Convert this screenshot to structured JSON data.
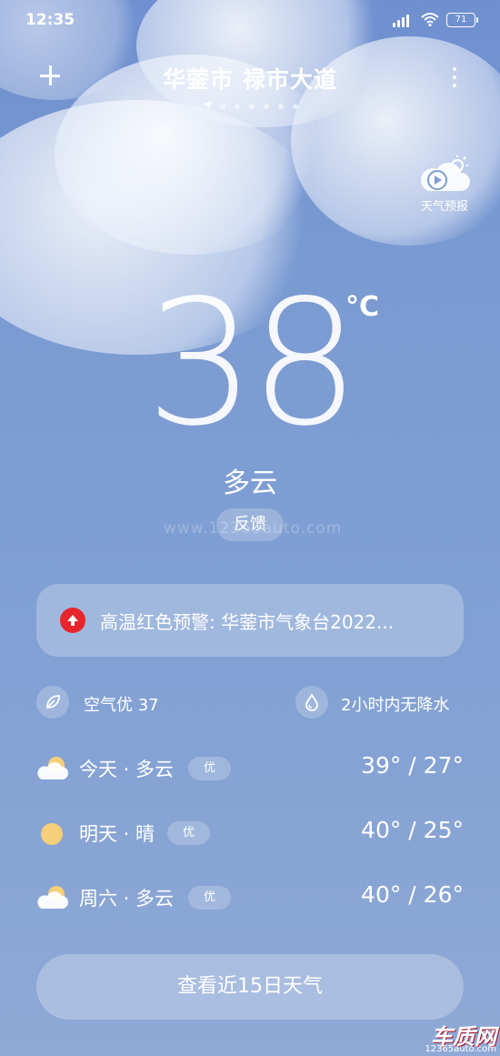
{
  "status_bar": {
    "time": "12:35",
    "battery": "71"
  },
  "header": {
    "location": "华蓥市 禄市大道",
    "forecast_video_label": "天气预报"
  },
  "current": {
    "temperature": "38",
    "unit": "°C",
    "condition": "多云",
    "feedback_label": "反馈"
  },
  "alert": {
    "text": "高温红色预警: 华蓥市气象台2022...",
    "color": "#e6262c"
  },
  "air": {
    "label": "空气优 37",
    "icon": "leaf-icon"
  },
  "precip": {
    "label": "2小时内无降水",
    "icon": "water-drop-icon"
  },
  "forecast": [
    {
      "day": "今天 · 多云",
      "aq": "优",
      "range": "39° / 27°",
      "icon": "partly-cloudy-icon"
    },
    {
      "day": "明天 · 晴",
      "aq": "优",
      "range": "40° / 25°",
      "icon": "sun-icon"
    },
    {
      "day": "周六 · 多云",
      "aq": "优",
      "range": "40° / 26°",
      "icon": "partly-cloudy-icon"
    }
  ],
  "more_button": "查看近15日天气",
  "watermark": "www.12365auto.com",
  "logo": {
    "main": "车质网",
    "sub": "12365auto.com"
  }
}
